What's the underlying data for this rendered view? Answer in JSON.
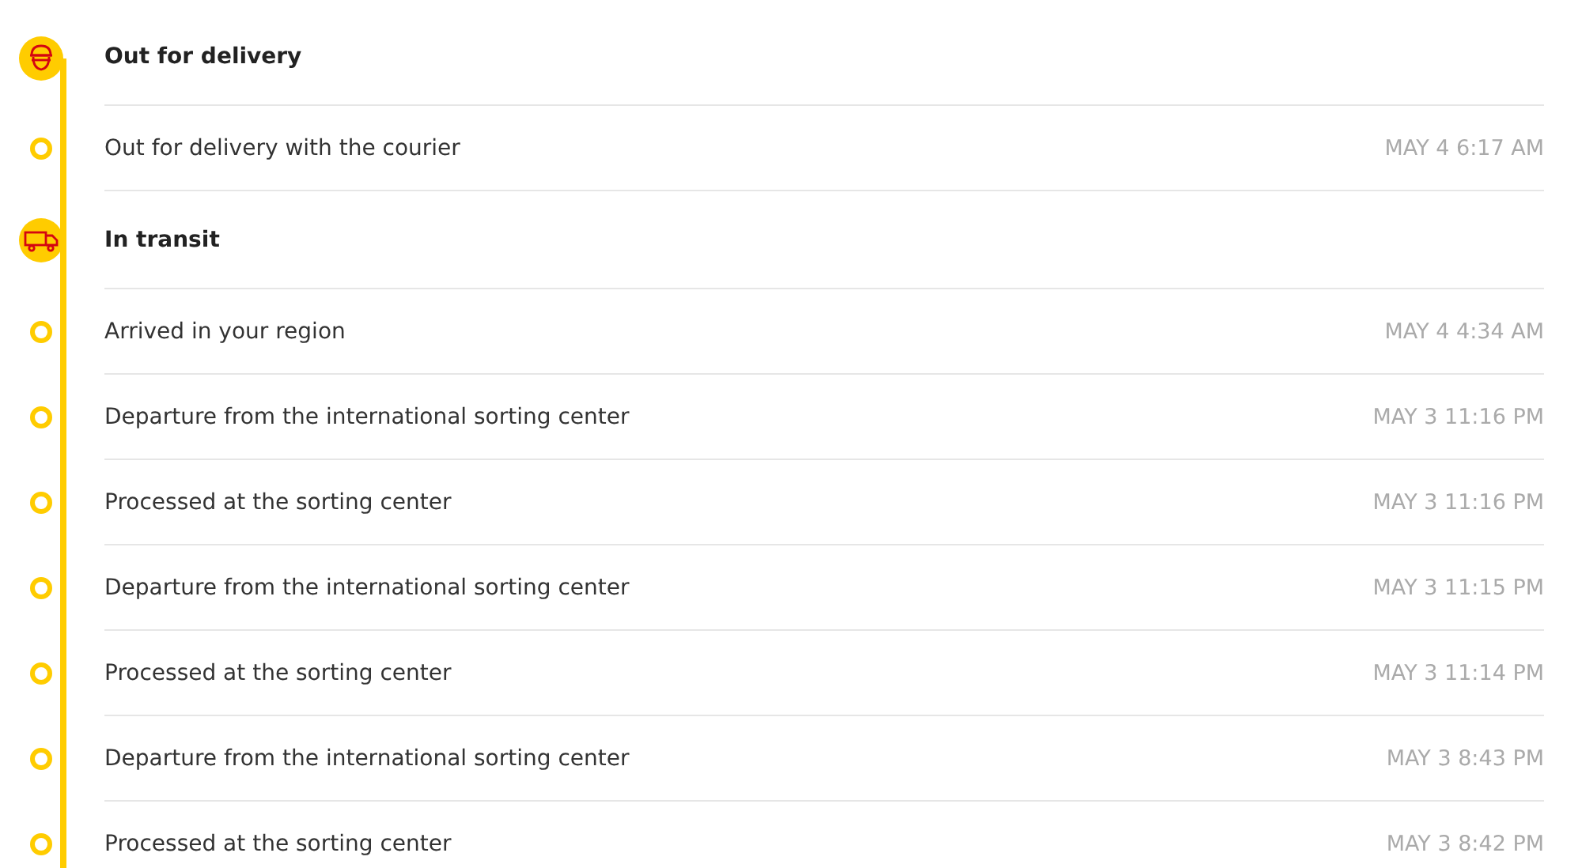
{
  "groups": [
    {
      "kind": "courier",
      "title": "Out for delivery",
      "events": [
        {
          "text": "Out for delivery with the courier",
          "time": "MAY 4 6:17 AM"
        }
      ]
    },
    {
      "kind": "truck",
      "title": "In transit",
      "events": [
        {
          "text": "Arrived in your region",
          "time": "MAY 4 4:34 AM"
        },
        {
          "text": "Departure from the international sorting center",
          "time": "MAY 3 11:16 PM"
        },
        {
          "text": "Processed at the sorting center",
          "time": "MAY 3 11:16 PM"
        },
        {
          "text": "Departure from the international sorting center",
          "time": "MAY 3 11:15 PM"
        },
        {
          "text": "Processed at the sorting center",
          "time": "MAY 3 11:14 PM"
        },
        {
          "text": "Departure from the international sorting center",
          "time": "MAY 3 8:43 PM"
        },
        {
          "text": "Processed at the sorting center",
          "time": "MAY 3 8:42 PM"
        }
      ]
    }
  ]
}
